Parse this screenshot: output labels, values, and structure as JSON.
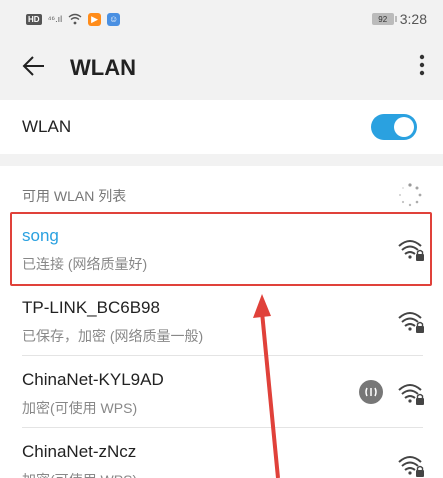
{
  "status_bar": {
    "hd": "HD",
    "signal": "⁴⁶.ıl",
    "battery": "92",
    "time": "3:28"
  },
  "app_bar": {
    "title": "WLAN"
  },
  "wlan_toggle": {
    "label": "WLAN",
    "enabled": true
  },
  "network_list": {
    "header": "可用 WLAN 列表",
    "networks": [
      {
        "name": "song",
        "status": "已连接 (网络质量好)",
        "icon": "wifi-lock-icon"
      },
      {
        "name": "TP-LINK_BC6B98",
        "status": "已保存，加密 (网络质量一般)",
        "icon": "wifi-lock-icon"
      },
      {
        "name": "ChinaNet-KYL9AD",
        "status": "加密(可使用 WPS)",
        "icon": "wifi-lock-icon",
        "wps": true
      },
      {
        "name": "ChinaNet-zNcz",
        "status": "加密(可使用 WPS)",
        "icon": "wifi-lock-icon"
      }
    ]
  },
  "colors": {
    "accent": "#2aa1e0",
    "highlight": "#e0413a"
  }
}
